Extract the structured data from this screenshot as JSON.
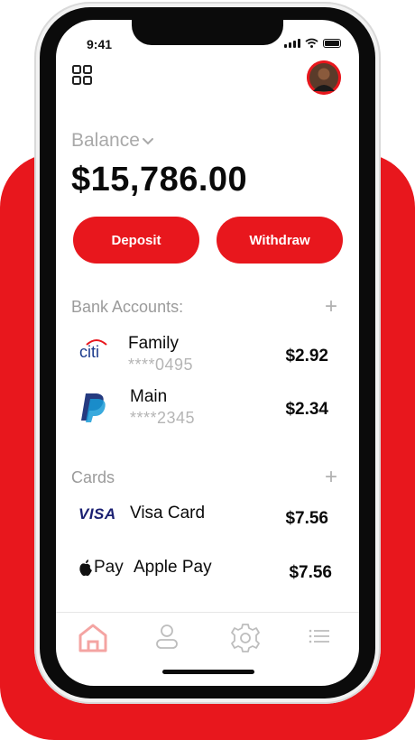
{
  "status": {
    "time": "9:41"
  },
  "balance": {
    "label": "Balance",
    "amount": "$15,786.00"
  },
  "actions": {
    "deposit_label": "Deposit",
    "withdraw_label": "Withdraw"
  },
  "bank_accounts": {
    "title": "Bank Accounts:",
    "add_symbol": "+",
    "items": [
      {
        "logo_text": "citi",
        "logo_icon": "citi-logo-icon",
        "name": "Family",
        "number": "****0495",
        "amount": "$2.92"
      },
      {
        "logo_text": "",
        "logo_icon": "paypal-logo-icon",
        "name": "Main",
        "number": "****2345",
        "amount": "$2.34"
      }
    ]
  },
  "cards": {
    "title": "Cards",
    "add_symbol": "+",
    "items": [
      {
        "logo_text": "VISA",
        "logo_icon": "visa-logo-icon",
        "name": "Visa Card",
        "amount": "$7.56"
      },
      {
        "logo_text": "Pay",
        "logo_icon": "apple-pay-logo-icon",
        "name": "Apple Pay",
        "amount": "$7.56"
      }
    ]
  },
  "tabs": [
    {
      "icon": "home-icon",
      "active": true
    },
    {
      "icon": "user-icon",
      "active": false
    },
    {
      "icon": "gear-icon",
      "active": false
    },
    {
      "icon": "list-icon",
      "active": false
    }
  ],
  "colors": {
    "accent": "#e8171d",
    "muted": "#a9a9a9",
    "text": "#0a0a0a"
  }
}
